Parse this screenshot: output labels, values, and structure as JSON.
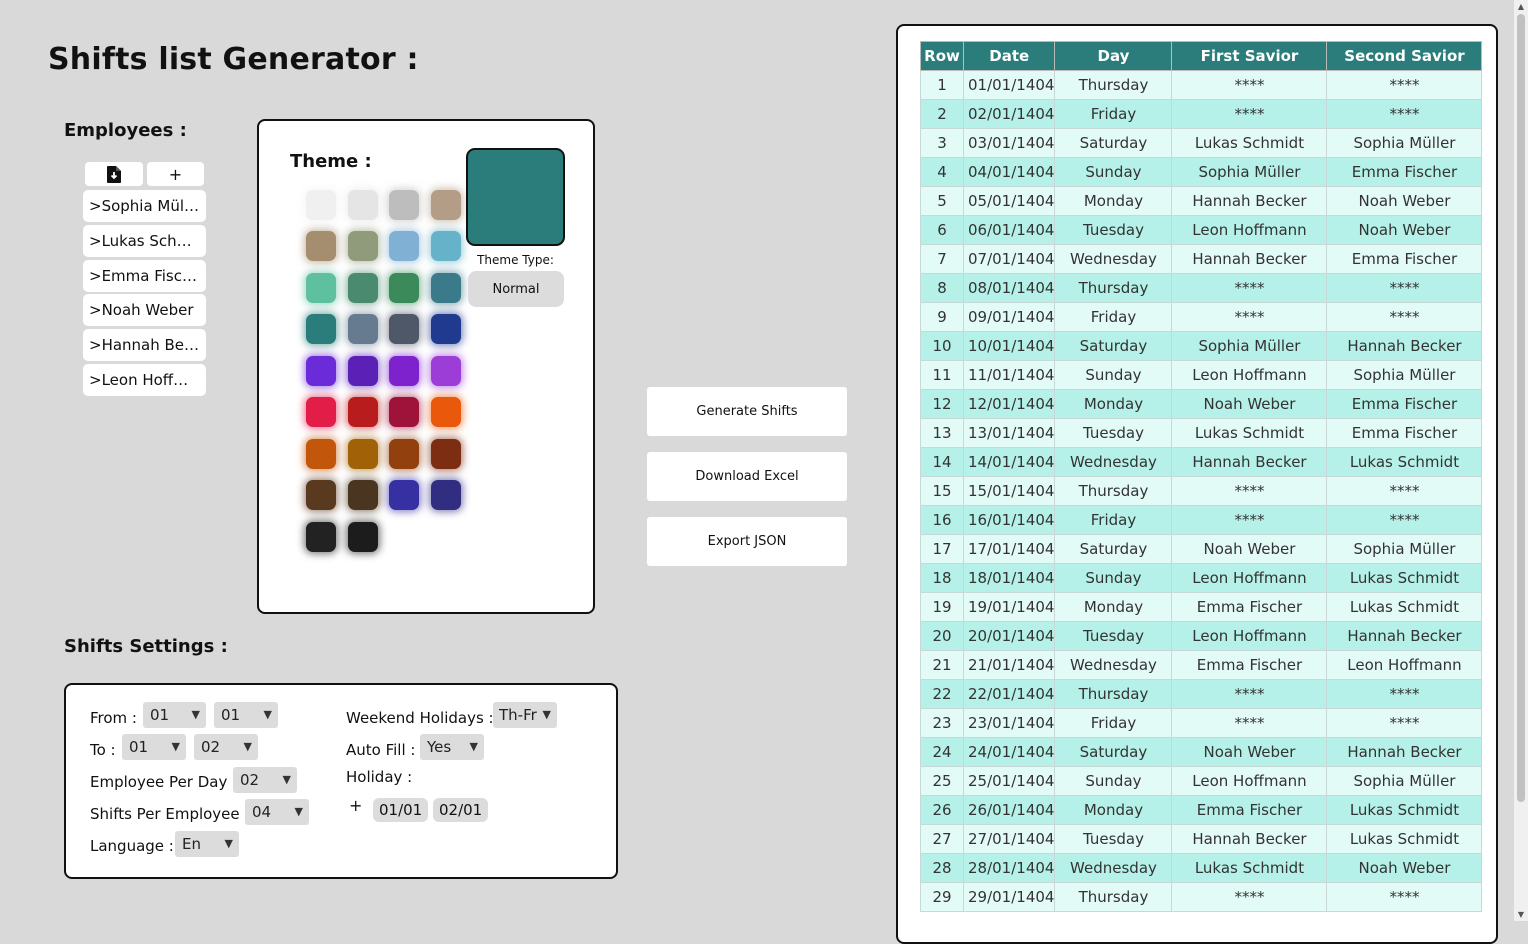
{
  "title": "Shifts list Generator :",
  "employees": {
    "heading": "Employees :",
    "add_label": "+",
    "items": [
      {
        "label": ">Sophia Müller"
      },
      {
        "label": ">Lukas Schmidt"
      },
      {
        "label": ">Emma Fischer"
      },
      {
        "label": ">Noah Weber"
      },
      {
        "label": ">Hannah Becker"
      },
      {
        "label": ">Leon Hoffmann"
      }
    ]
  },
  "theme": {
    "heading": "Theme :",
    "selected_color": "#2a7d7a",
    "type_label": "Theme Type:",
    "type_value": "Normal",
    "swatches": [
      "#f0f0f0",
      "#e5e5e5",
      "#bdbdbd",
      "#b39d86",
      "#a58d6f",
      "#8f9b7a",
      "#80b0d4",
      "#66b3c9",
      "#5fc0a0",
      "#4a8a6f",
      "#3a8a5a",
      "#3b7a8a",
      "#2a7d7a",
      "#667a90",
      "#4f5868",
      "#1f3a8f",
      "#6c2bd9",
      "#5b21b6",
      "#7e22ce",
      "#9b3dd6",
      "#e11d48",
      "#b91c1c",
      "#9f1239",
      "#ea580c",
      "#c2570c",
      "#a16207",
      "#92400e",
      "#7c2d12",
      "#5a3a1f",
      "#4a3520",
      "#3730a3",
      "#312e81",
      "#222222",
      "#1c1c1c"
    ]
  },
  "actions": {
    "generate": "Generate Shifts",
    "download": "Download Excel",
    "export": "Export JSON"
  },
  "settings": {
    "heading": "Shifts Settings :",
    "from_label": "From :",
    "from_day": "01",
    "from_month": "01",
    "to_label": "To :",
    "to_day": "01",
    "to_month": "02",
    "emp_per_day_label": "Employee Per Day :",
    "emp_per_day": "02",
    "shifts_per_emp_label": "Shifts Per Employee :",
    "shifts_per_emp": "04",
    "language_label": "Language :",
    "language": "En",
    "weekend_label": "Weekend Holidays :",
    "weekend": "Th-Fr",
    "autofill_label": "Auto Fill :",
    "autofill": "Yes",
    "holiday_label": "Holiday :",
    "holiday_add": "+",
    "holidays": [
      "01/01",
      "02/01"
    ]
  },
  "table": {
    "headers": [
      "Row",
      "Date",
      "Day",
      "First Savior",
      "Second Savior"
    ],
    "rows": [
      [
        "1",
        "01/01/1404",
        "Thursday",
        "****",
        "****"
      ],
      [
        "2",
        "02/01/1404",
        "Friday",
        "****",
        "****"
      ],
      [
        "3",
        "03/01/1404",
        "Saturday",
        "Lukas Schmidt",
        "Sophia Müller"
      ],
      [
        "4",
        "04/01/1404",
        "Sunday",
        "Sophia Müller",
        "Emma Fischer"
      ],
      [
        "5",
        "05/01/1404",
        "Monday",
        "Hannah Becker",
        "Noah Weber"
      ],
      [
        "6",
        "06/01/1404",
        "Tuesday",
        "Leon Hoffmann",
        "Noah Weber"
      ],
      [
        "7",
        "07/01/1404",
        "Wednesday",
        "Hannah Becker",
        "Emma Fischer"
      ],
      [
        "8",
        "08/01/1404",
        "Thursday",
        "****",
        "****"
      ],
      [
        "9",
        "09/01/1404",
        "Friday",
        "****",
        "****"
      ],
      [
        "10",
        "10/01/1404",
        "Saturday",
        "Sophia Müller",
        "Hannah Becker"
      ],
      [
        "11",
        "11/01/1404",
        "Sunday",
        "Leon Hoffmann",
        "Sophia Müller"
      ],
      [
        "12",
        "12/01/1404",
        "Monday",
        "Noah Weber",
        "Emma Fischer"
      ],
      [
        "13",
        "13/01/1404",
        "Tuesday",
        "Lukas Schmidt",
        "Emma Fischer"
      ],
      [
        "14",
        "14/01/1404",
        "Wednesday",
        "Hannah Becker",
        "Lukas Schmidt"
      ],
      [
        "15",
        "15/01/1404",
        "Thursday",
        "****",
        "****"
      ],
      [
        "16",
        "16/01/1404",
        "Friday",
        "****",
        "****"
      ],
      [
        "17",
        "17/01/1404",
        "Saturday",
        "Noah Weber",
        "Sophia Müller"
      ],
      [
        "18",
        "18/01/1404",
        "Sunday",
        "Leon Hoffmann",
        "Lukas Schmidt"
      ],
      [
        "19",
        "19/01/1404",
        "Monday",
        "Emma Fischer",
        "Lukas Schmidt"
      ],
      [
        "20",
        "20/01/1404",
        "Tuesday",
        "Leon Hoffmann",
        "Hannah Becker"
      ],
      [
        "21",
        "21/01/1404",
        "Wednesday",
        "Emma Fischer",
        "Leon Hoffmann"
      ],
      [
        "22",
        "22/01/1404",
        "Thursday",
        "****",
        "****"
      ],
      [
        "23",
        "23/01/1404",
        "Friday",
        "****",
        "****"
      ],
      [
        "24",
        "24/01/1404",
        "Saturday",
        "Noah Weber",
        "Hannah Becker"
      ],
      [
        "25",
        "25/01/1404",
        "Sunday",
        "Leon Hoffmann",
        "Sophia Müller"
      ],
      [
        "26",
        "26/01/1404",
        "Monday",
        "Emma Fischer",
        "Lukas Schmidt"
      ],
      [
        "27",
        "27/01/1404",
        "Tuesday",
        "Hannah Becker",
        "Lukas Schmidt"
      ],
      [
        "28",
        "28/01/1404",
        "Wednesday",
        "Lukas Schmidt",
        "Noah Weber"
      ],
      [
        "29",
        "29/01/1404",
        "Thursday",
        "****",
        "****"
      ]
    ]
  }
}
